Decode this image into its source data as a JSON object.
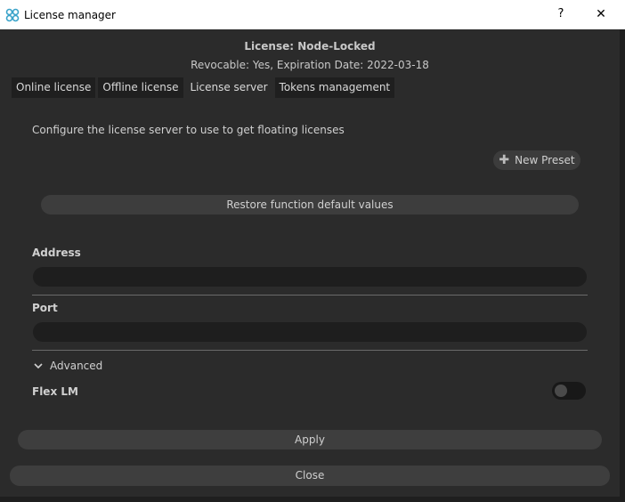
{
  "window": {
    "title": "License manager",
    "help_label": "?",
    "close_label": "✕"
  },
  "license": {
    "title": "License: Node-Locked",
    "subtitle": "Revocable: Yes, Expiration Date: 2022-03-18"
  },
  "tabs": [
    {
      "label": "Online license",
      "active": false
    },
    {
      "label": "Offline license",
      "active": false
    },
    {
      "label": "License server",
      "active": true
    },
    {
      "label": "Tokens management",
      "active": false
    }
  ],
  "main": {
    "description": "Configure the license server to use to get floating licenses",
    "new_preset_label": "New Preset",
    "restore_label": "Restore function default values",
    "address_label": "Address",
    "address_value": "",
    "port_label": "Port",
    "port_value": "",
    "advanced_label": "Advanced",
    "flexlm_label": "Flex LM",
    "flexlm_enabled": false
  },
  "footer": {
    "apply_label": "Apply",
    "close_label": "Close"
  },
  "colors": {
    "background": "#2b2b2b",
    "titlebar": "#ffffff",
    "logo": "#3aa3c9",
    "button": "#3e3e3e",
    "input": "#1e1e1e"
  }
}
